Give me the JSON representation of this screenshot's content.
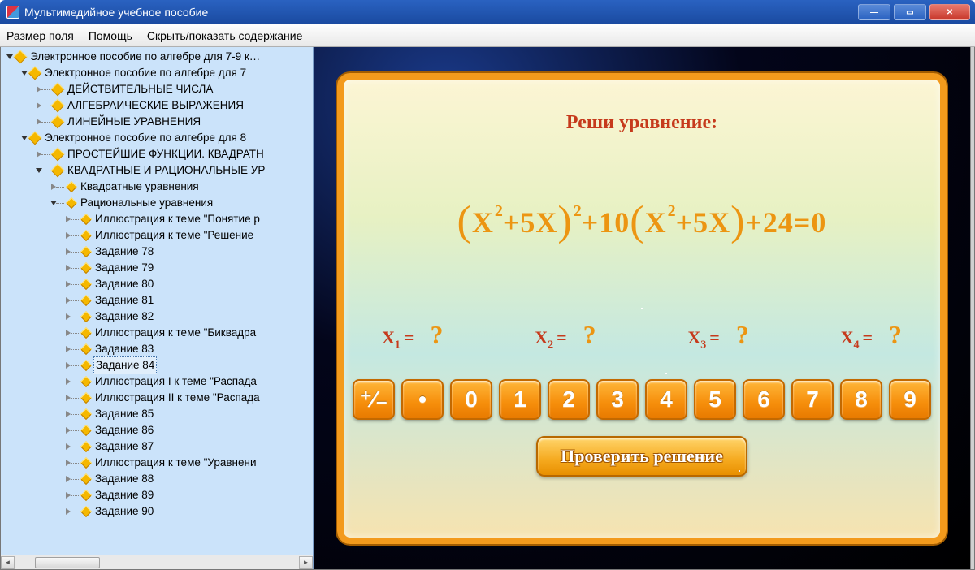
{
  "window": {
    "title": "Мультимедийное учебное пособие"
  },
  "menu": {
    "size": "Размер поля",
    "help": "Помощь",
    "toggle": "Скрыть/показать содержание"
  },
  "tree": [
    {
      "ind": 0,
      "tg": "open",
      "lbl": "Электронное пособие по алгебре для 7-9 к…"
    },
    {
      "ind": 1,
      "tg": "open",
      "lbl": "Электронное пособие по алгебре для 7"
    },
    {
      "ind": 2,
      "tg": "closed",
      "lbl": "ДЕЙСТВИТЕЛЬНЫЕ ЧИСЛА"
    },
    {
      "ind": 2,
      "tg": "closed",
      "lbl": "АЛГЕБРАИЧЕСКИЕ ВЫРАЖЕНИЯ"
    },
    {
      "ind": 2,
      "tg": "closed",
      "lbl": "ЛИНЕЙНЫЕ УРАВНЕНИЯ"
    },
    {
      "ind": 1,
      "tg": "open",
      "lbl": "Электронное пособие по алгебре для 8"
    },
    {
      "ind": 2,
      "tg": "closed",
      "lbl": "ПРОСТЕЙШИЕ ФУНКЦИИ. КВАДРАТН"
    },
    {
      "ind": 2,
      "tg": "open",
      "lbl": "КВАДРАТНЫЕ И РАЦИОНАЛЬНЫЕ УР"
    },
    {
      "ind": 3,
      "tg": "closed",
      "lbl": "Квадратные уравнения"
    },
    {
      "ind": 3,
      "tg": "open",
      "lbl": "Рациональные уравнения"
    },
    {
      "ind": 4,
      "tg": "closed",
      "lbl": "Иллюстрация к теме \"Понятие р"
    },
    {
      "ind": 4,
      "tg": "closed",
      "lbl": "Иллюстрация к теме \"Решение"
    },
    {
      "ind": 4,
      "tg": "closed",
      "lbl": "Задание 78"
    },
    {
      "ind": 4,
      "tg": "closed",
      "lbl": "Задание 79"
    },
    {
      "ind": 4,
      "tg": "closed",
      "lbl": "Задание 80"
    },
    {
      "ind": 4,
      "tg": "closed",
      "lbl": "Задание 81"
    },
    {
      "ind": 4,
      "tg": "closed",
      "lbl": "Задание 82"
    },
    {
      "ind": 4,
      "tg": "closed",
      "lbl": "Иллюстрация к теме \"Биквадра"
    },
    {
      "ind": 4,
      "tg": "closed",
      "lbl": "Задание 83"
    },
    {
      "ind": 4,
      "tg": "closed",
      "lbl": "Задание 84",
      "sel": true
    },
    {
      "ind": 4,
      "tg": "closed",
      "lbl": "Иллюстрация I к теме \"Распада"
    },
    {
      "ind": 4,
      "tg": "closed",
      "lbl": "Иллюстрация II к теме \"Распада"
    },
    {
      "ind": 4,
      "tg": "closed",
      "lbl": "Задание 85"
    },
    {
      "ind": 4,
      "tg": "closed",
      "lbl": "Задание 86"
    },
    {
      "ind": 4,
      "tg": "closed",
      "lbl": "Задание 87"
    },
    {
      "ind": 4,
      "tg": "closed",
      "lbl": "Иллюстрация к теме \"Уравнени"
    },
    {
      "ind": 4,
      "tg": "closed",
      "lbl": "Задание 88"
    },
    {
      "ind": 4,
      "tg": "closed",
      "lbl": "Задание 89"
    },
    {
      "ind": 4,
      "tg": "closed",
      "lbl": "Задание 90"
    }
  ],
  "task": {
    "prompt": "Реши уравнение:",
    "equation_parts": {
      "a": "X",
      "sup1": "2",
      "b": "+5X",
      "sup2": "2",
      "c": "+10",
      "d": "X",
      "sup3": "2",
      "e": "+5X",
      "f": "+24=0"
    },
    "answers": [
      {
        "var": "X",
        "sub": "1",
        "val": "?"
      },
      {
        "var": "X",
        "sub": "2",
        "val": "?"
      },
      {
        "var": "X",
        "sub": "3",
        "val": "?"
      },
      {
        "var": "X",
        "sub": "4",
        "val": "?"
      }
    ],
    "keypad": [
      "⁺⁄₋",
      "•",
      "0",
      "1",
      "2",
      "3",
      "4",
      "5",
      "6",
      "7",
      "8",
      "9"
    ],
    "check": "Проверить решение"
  }
}
